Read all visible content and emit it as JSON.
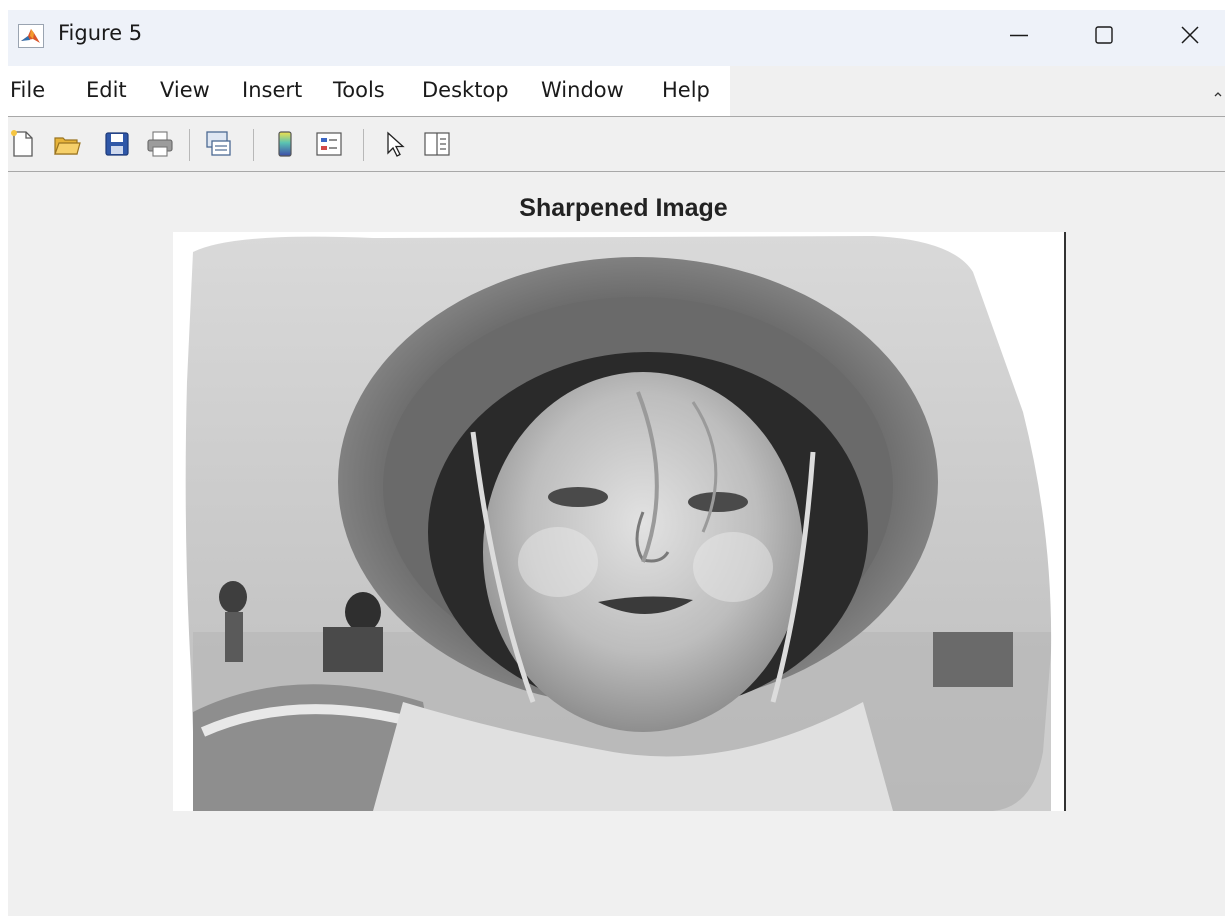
{
  "window": {
    "title": "Figure 5",
    "app_icon": "matlab-logo-icon"
  },
  "window_controls": {
    "minimize": "minimize-icon",
    "maximize": "maximize-icon",
    "close": "close-icon"
  },
  "menubar": {
    "items": [
      "File",
      "Edit",
      "View",
      "Insert",
      "Tools",
      "Desktop",
      "Window",
      "Help"
    ]
  },
  "toolbar": {
    "buttons": [
      "new-figure-icon",
      "open-file-icon",
      "save-icon",
      "print-icon",
      "link-plot-icon",
      "insert-colorbar-icon",
      "insert-legend-icon",
      "edit-plot-icon",
      "property-inspector-icon"
    ]
  },
  "figure": {
    "axes_title": "Sharpened Image",
    "image_description_icon": "grayscale-photo-child-with-hat",
    "colors": {
      "figure_background": "#f0f0f0",
      "titlebar_background": "#eef2f9",
      "axis_color": "#333333"
    }
  }
}
